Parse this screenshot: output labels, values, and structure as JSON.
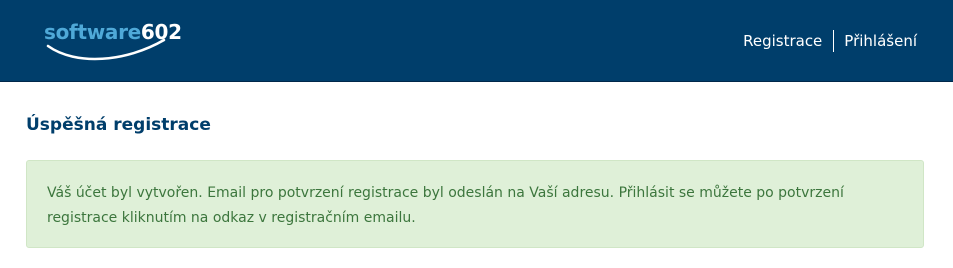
{
  "header": {
    "logo": {
      "part1": "software",
      "part2": "602"
    },
    "nav": {
      "register_label": "Registrace",
      "login_label": "Přihlášení"
    }
  },
  "main": {
    "title": "Úspěšná registrace",
    "alert_text": "Váš účet byl vytvořen. Email pro potvrzení registrace byl odeslán na Vaší adresu. Přihlásit se můžete po potvrzení registrace kliknutím na odkaz v registračním emailu."
  },
  "colors": {
    "header_bg": "#003e6b",
    "logo_blue": "#4fa9d8",
    "title": "#003e6b",
    "alert_bg": "#dff0d8",
    "alert_text": "#3c763d"
  }
}
